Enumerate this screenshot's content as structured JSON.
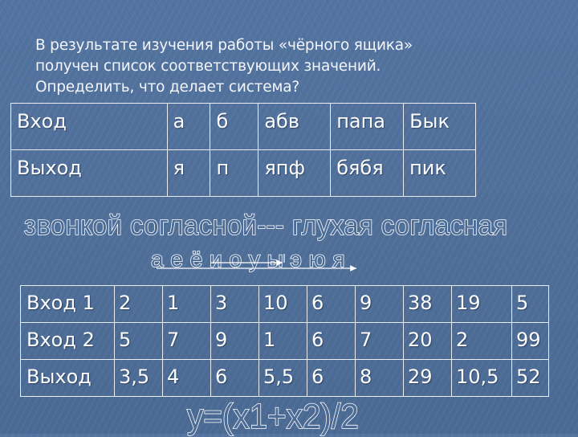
{
  "intro": {
    "lines": [
      "В результате изучения работы «чёрного ящика»",
      "получен список соответствующих значений.",
      "Определить, что делает система?"
    ]
  },
  "table1": {
    "rows": [
      [
        "Вход",
        "а",
        "б",
        "абв",
        "папа",
        "Бык"
      ],
      [
        "Выход",
        "я",
        "п",
        "япф",
        "бябя",
        "пик"
      ]
    ]
  },
  "rule": {
    "text": "звонкой согласной--- глухая согласная",
    "vowels": "а е ё и о у ы э ю я",
    "arrows": [
      {
        "from": "и",
        "to": "ы"
      },
      {
        "from": "а",
        "to": "я"
      }
    ]
  },
  "table2": {
    "rows": [
      [
        "Вход 1",
        "2",
        "1",
        "3",
        "10",
        "6",
        "9",
        "38",
        "19",
        "5"
      ],
      [
        "Вход 2",
        "5",
        "7",
        "9",
        "1",
        "6",
        "7",
        "20",
        "2",
        "99"
      ],
      [
        "Выход",
        "3,5",
        "4",
        "6",
        "5,5",
        "6",
        "8",
        "29",
        "10,5",
        "52"
      ]
    ]
  },
  "formula": "y=(x1+x2)/2",
  "colors": {
    "background": "#4f6f98",
    "text": "#ffffff",
    "grid": "#e9eef5"
  }
}
